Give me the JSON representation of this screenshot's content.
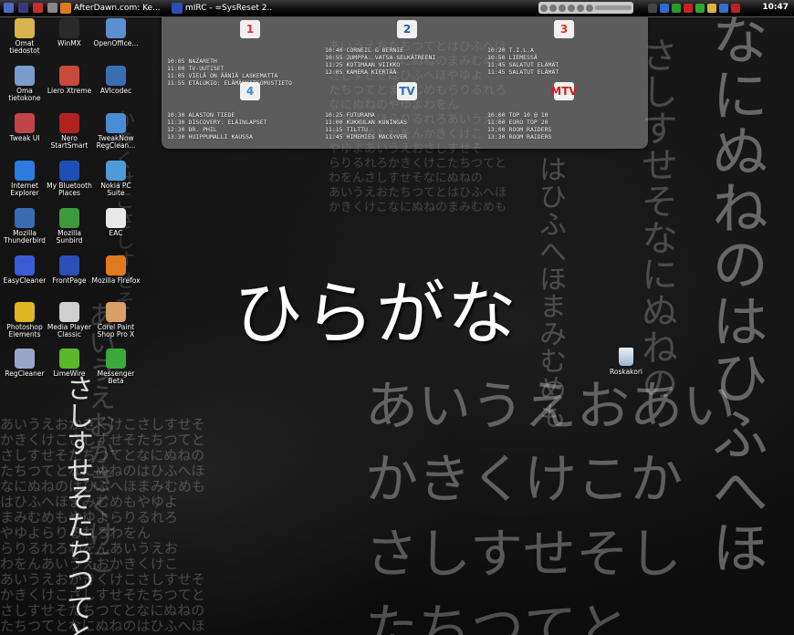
{
  "taskbar": {
    "windows": [
      {
        "title": "AfterDawn.com: Ke..."
      },
      {
        "title": "mIRC - =SysReset 2..."
      }
    ],
    "clock": "10:47"
  },
  "desktop_icons": [
    {
      "label": "Omat tiedostot",
      "icon": "folder-icon",
      "color": "#d8b44a"
    },
    {
      "label": "WinMX",
      "icon": "winmx-icon",
      "color": "#2a2a2a"
    },
    {
      "label": "OpenOffice...",
      "icon": "openoffice-icon",
      "color": "#5b8fd0"
    },
    {
      "label": "Oma tietokone",
      "icon": "computer-icon",
      "color": "#7a9ccc"
    },
    {
      "label": "Liero Xtreme",
      "icon": "worm-icon",
      "color": "#c84a3a"
    },
    {
      "label": "AVIcodec",
      "icon": "avicodec-icon",
      "color": "#3b6db1"
    },
    {
      "label": "Tweak UI",
      "icon": "tweakui-icon",
      "color": "#c2444a"
    },
    {
      "label": "Nero StartSmart",
      "icon": "nero-icon",
      "color": "#b22222"
    },
    {
      "label": "TweakNow RegClean...",
      "icon": "tweaknow-icon",
      "color": "#4b8cd6"
    },
    {
      "label": "Internet Explorer",
      "icon": "ie-icon",
      "color": "#2d7be0"
    },
    {
      "label": "My Bluetooth Places",
      "icon": "bluetooth-icon",
      "color": "#1e4fb5"
    },
    {
      "label": "Nokia PC Suite",
      "icon": "nokia-icon",
      "color": "#4f9ad8"
    },
    {
      "label": "Mozilla Thunderbird",
      "icon": "thunderbird-icon",
      "color": "#3a6bb5"
    },
    {
      "label": "Mozilla Sunbird",
      "icon": "sunbird-icon",
      "color": "#3c9a3c"
    },
    {
      "label": "EAC",
      "icon": "eac-icon",
      "color": "#e8e8e8"
    },
    {
      "label": "EasyCleaner",
      "icon": "easycleaner-icon",
      "color": "#3b5bd6"
    },
    {
      "label": "FrontPage",
      "icon": "frontpage-icon",
      "color": "#2d4fb8"
    },
    {
      "label": "Mozilla Firefox",
      "icon": "firefox-icon",
      "color": "#e07a1f"
    },
    {
      "label": "Photoshop Elements",
      "icon": "photoshop-icon",
      "color": "#e0b422"
    },
    {
      "label": "Media Player Classic",
      "icon": "mediaplayer-icon",
      "color": "#cfcfcf"
    },
    {
      "label": "Corel Paint Shop Pro X",
      "icon": "paintshop-icon",
      "color": "#d9a066"
    },
    {
      "label": "RegCleaner",
      "icon": "regcleaner-icon",
      "color": "#9aa6c8"
    },
    {
      "label": "LimeWire",
      "icon": "limewire-icon",
      "color": "#5ab82a"
    },
    {
      "label": "Messenger Beta",
      "icon": "messenger-icon",
      "color": "#3aa83a"
    }
  ],
  "recycle_bin": {
    "label": "Roskakori",
    "icon": "recycle-bin-icon"
  },
  "tv_guide": {
    "channels": [
      {
        "logo": "1",
        "icon": "yle1-logo-icon",
        "color": "#e03030",
        "programs": [
          "10:05 NAZARETH",
          "11:00 TV-UUTISET",
          "11:05 VIELÄ ON ÄÄNIÄ LASKEMATTA",
          "11:55 ETÄLUKIO: ELÄMÄNKATSOMUSTIETO"
        ]
      },
      {
        "logo": "2",
        "icon": "yle2-logo-icon",
        "color": "#1f5fb0",
        "programs": [
          "10:40 CORNEIL & BERNIE",
          "10:55 JUMPPA: VATSA-SELKÄTREENI",
          "11:25 KOTIMAAN VIIKKO",
          "12:05 KAMERA KIERTÄÄ"
        ]
      },
      {
        "logo": "3",
        "icon": "mtv3-logo-icon",
        "color": "#e03020",
        "programs": [
          "10:20 T.I.L.A",
          "10:50 LIEMESSÄ",
          "11:45 SALATUT ELÄMÄT",
          "11:45 SALATUT ELÄMÄT"
        ]
      },
      {
        "logo": "4",
        "icon": "nelonen-logo-icon",
        "color": "#3a8fd6",
        "programs": [
          "10:30 ALASTON TIEDE",
          "11:30 DISCOVERY: ELÄINLAPSET",
          "12:30 DR. PHIL",
          "13:30 HUIPPUMALLI KAUSSA"
        ]
      },
      {
        "logo": "TV",
        "icon": "subtv-logo-icon",
        "color": "#2a6fc8",
        "programs": [
          "10:25 FUTURAMA",
          "11:00 KUKKULAN KUNINGAS",
          "11:15 TILTTU",
          "11:45 HIMEMIES MACGYVER"
        ]
      },
      {
        "logo": "MTV",
        "icon": "mtv-logo-icon",
        "color": "#d02020",
        "programs": [
          "10:00 TOP 10 @ 10",
          "11:00 EURO TOP 20",
          "13:00 ROOM RAIDERS",
          "13:30 ROOM RAIDERS"
        ]
      }
    ]
  },
  "wallpaper": {
    "headline": "ひらがな",
    "rows": [
      "あいうえお",
      "かきくけこ",
      "さしすせそ",
      "たちつてと",
      "なにぬねの",
      "はひふへほ",
      "まみむめも",
      "やゆよ",
      "らりるれろ",
      "わをん"
    ]
  }
}
